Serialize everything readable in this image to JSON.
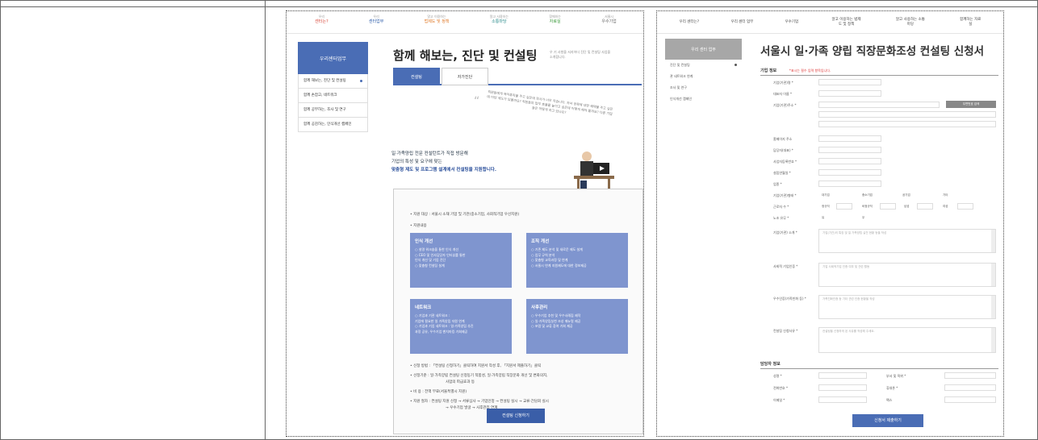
{
  "colors": {
    "accent": "#4a6db5",
    "card": "#7f95cf",
    "required": "#d33333",
    "border": "#666666"
  },
  "left_page": {
    "gnb": [
      {
        "top": "우리",
        "bottom": "센터는?",
        "color": "red"
      },
      {
        "top": "우리",
        "bottom": "센터업무",
        "color": "blue"
      },
      {
        "top": "알고 이용하는",
        "bottom": "법제도 및 정책",
        "color": "orange"
      },
      {
        "top": "알고 사용하는",
        "bottom": "소통마당",
        "color": "teal"
      },
      {
        "top": "함께하는",
        "bottom": "자료실",
        "color": "green"
      },
      {
        "top": "서울시",
        "bottom": "우수기업",
        "color": "gray"
      }
    ],
    "lnb_title": "우리센터업무",
    "lnb_items": [
      "함께 해보는, 진단 및 컨설팅",
      "함께 손잡고, 네트워크",
      "함께 공부하는, 조사 및 연구",
      "함께 공감하는, 인식개선 캠페인"
    ],
    "page_title": "함께 해보는, 진단 및 컨설팅",
    "page_sub": "우 기 사항을 서지어더 진단 및 컨설팅 사업을 소개합니다.",
    "tabs": [
      "컨설팅",
      "자가진단"
    ],
    "quote": "직원들에게 육아휴직을 주고 싶은데 회사가 너무 작습니다. 자녀 양육에 대한 혜택을 주고 싶은데 어떤 제도가 있을까요? 직원들의 업무 효율을 높이고 싶은데 어떻게 해야 할까요? 다른 기업들은 어떻게 하고 있나요?",
    "intro_line1": "일·가족양립 전문 컨설턴트가 직접 방문해",
    "intro_line2": "기업의 특성 및 요구에 맞는",
    "intro_line3": "맞춤형 제도 및 프로그램 설계에서 컨설팅을 지원합니다.",
    "target": "• 지원 대상 :   서울시 소재 기업 및 기관(중소기업, 사회적기업 우선지원)",
    "content_label": "• 지원내용",
    "cards": [
      {
        "title": "인식 개선",
        "lines": [
          "○ 설명 워크숍을 통한 인식 개선",
          "○ CEO 및 인사담당자 인터뷰를 통한",
          "   인식 개선 및 기업 진단",
          "○ 맞춤형 컨설팅 설계"
        ]
      },
      {
        "title": "조직 개선",
        "lines": [
          "○ 기존 제도 분석 및 새로운 제도 설계",
          "○ 업무 규칙 분석",
          "○ 맞춤형 교육과정 및 연계",
          "○ 서울시 연계 지원제도에 대한 정보제공"
        ]
      },
      {
        "title": "네트워크",
        "lines": [
          "○ 기업과 기관 네트워크 :",
          "   기업에 필요한 일 가족양립 자원 연계",
          "○ 기업과 기업 네트워크 : 일·가족양립 추진",
          "   과정 공유, 우수기업 벤치마킹 기회제공"
        ]
      },
      {
        "title": "사후관리",
        "lines": [
          "○ 우수기업 추천 및 우수사례집 제작",
          "○ 일·가족양립실천 조성 매뉴얼 제공",
          "○ 포럼 및 교류 참여 기회 제공"
        ]
      }
    ],
    "method": "• 신청 방법 :  「컨설팅 신청하기」클릭하여 지원서 작성 후, 「지원서 제출하기」클릭",
    "criteria1": "• 선정기준 :   일·가족양립 컨설팅 신청동기 적합성, 일·가족양립 직장문화 개선 및 변화의지,",
    "criteria2": "사업의 파급효과 등",
    "cost": "• 비       용 :   전액 무료(서울특별시 지원)",
    "process1": "• 지원 절차 :   컨설팅 지원 신청  → 서류심사  → 기업인정  → 컨설팅 실시  → 교류·간담회 실시",
    "process2": "→ 우수기업 발굴  → 사후관리 연계",
    "apply_button": "컨설팅 신청하기"
  },
  "right_page": {
    "gnb": [
      "우리 센터는?",
      "우리 센터 업무",
      "우수기업",
      "알고 이용하는 법제도 및 정책",
      "알고 사용하는 소통마당",
      "함께하는 자료실"
    ],
    "lnb_title": "우리 센터 업무",
    "lnb_items": [
      "진단 및 컨설팅",
      "관 네트워크 연계",
      "조사 및 연구",
      "인식개선 캠페인"
    ],
    "page_title": "서울시 일·가족 양립 직장문화조성 컨설팅 신청서",
    "section_company": "기업 정보",
    "required_note": "*표시는 필수 입력 항목입니다.",
    "fields": [
      "기업(기관)명 *",
      "대표자 이름 *",
      "기업(기관)주소 *",
      "홈페이지 주소",
      "담당자(대표) *",
      "사업자등록번호 *",
      "설립연월일 *",
      "업종 *",
      "기업(기관)형태 *",
      "근로자 수 *",
      "노조 유무 *"
    ],
    "address_button": "우편번호 검색",
    "org_types": [
      "대기업",
      "중소기업",
      "공기업",
      "기타"
    ],
    "workers": [
      "정규직",
      "비정규직",
      "남성",
      "여성"
    ],
    "union": [
      "유",
      "무"
    ],
    "textareas": [
      {
        "label": "기업(기관) 소개 *",
        "hint": "기업(기관)의 특징 및 일 가족양립 실천 현황 등을 작성"
      },
      {
        "label": "사회적 기업인증 *",
        "hint": "기업 사회적기업 인증 여부 및 관련 활동"
      },
      {
        "label": "우수인증(가족친화 등) *",
        "hint": "가족친화인증 등 기타 관련 인증 현황을 작성"
      },
      {
        "label": "컨설팅 신청사유 *",
        "hint": "컨설팅을 신청하게 된 사유를 작성해 주세요."
      }
    ],
    "section_manager": "담당자 정보",
    "manager_fields": [
      "성명 *",
      "부서 및 직위 *",
      "전화번호 *",
      "휴대폰 *",
      "이메일 *",
      "팩스"
    ],
    "submit_button": "신청서 제출하기"
  }
}
